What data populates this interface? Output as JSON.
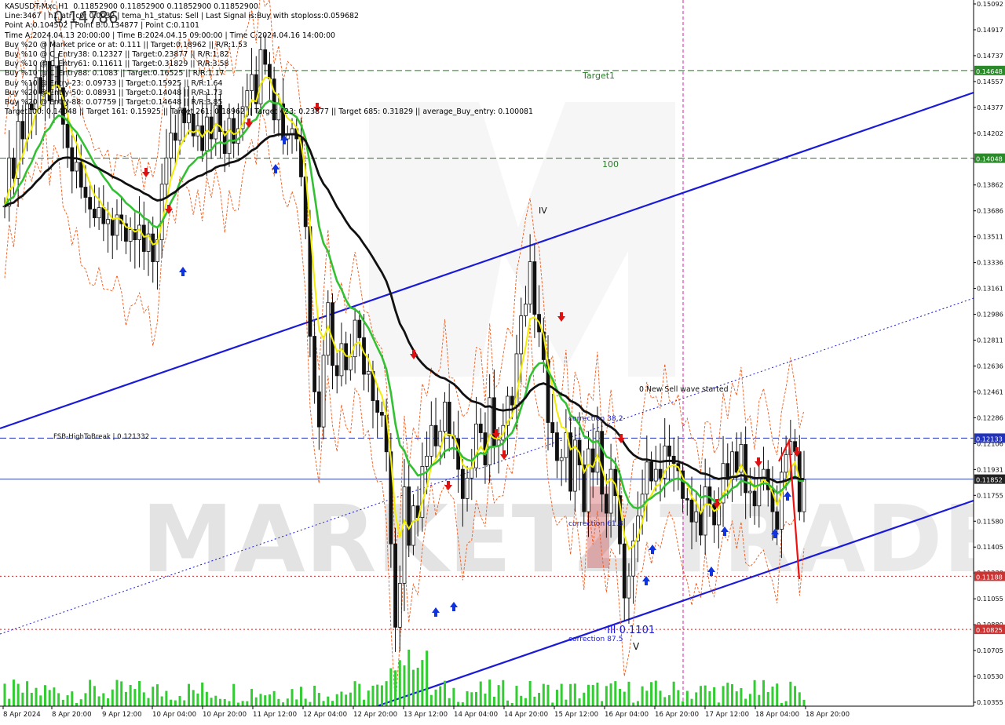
{
  "chart_data": {
    "type": "candlestick",
    "symbol": "KASUSDT-Mxc,H1",
    "ohlc_header": "0.11852900 0.11852900 0.11852900 0.11852900",
    "info_lines": [
      "KASUSDT-Mxc,H1  0.11852900 0.11852900 0.11852900 0.11852900",
      "Line:3467 | h1_atr_c0: 0.0032 | tema_h1_status: Sell | Last Signal is:Buy with stoploss:0.059682",
      "Point A:0.104502 | Point B:0.134877 | Point C:0.1101",
      "Time A:2024.04.13 20:00:00 | Time B:2024.04.15 09:00:00 | Time C:2024.04.16 14:00:00",
      "Buy %20 @ Market price or at: 0.111 || Target:0.18962 || R/R:1.53",
      "Buy %10 @ C_Entry38: 0.12327 || Target:0.23877 || R/R:1.82",
      "Buy %10 @ C_Entry61: 0.11611 || Target:0.31829 || R/R:3.58",
      "Buy %10 @ C_Entry88: 0.1083 || Target:0.16525 || R/R:1.17",
      "Buy %10 @ Entry-23: 0.09733 || Target:0.15925 || R/R:1.64",
      "Buy %20 @ Entry-50: 0.08931 || Target:0.14048 || R/R:1.73",
      "Buy %20 @ Entry-88: 0.07759 || Target:0.14648 || R/R:3.85",
      "Target100: 0.14048 || Target 161: 0.15925 || Target 261: 0.18962 || Target 423: 0.23877 || Target 685: 0.31829 || average_Buy_entry: 0.100081"
    ],
    "overlay_big_label": "0.14786",
    "y_ticks": [
      "0.15092",
      "0.14917",
      "0.14737",
      "0.14557",
      "0.14377",
      "0.14202",
      "0.14022",
      "0.13862",
      "0.13686",
      "0.13511",
      "0.13336",
      "0.13161",
      "0.12986",
      "0.12811",
      "0.12636",
      "0.12461",
      "0.12286",
      "0.12106",
      "0.11931",
      "0.11755",
      "0.11580",
      "0.11405",
      "0.11230",
      "0.11055",
      "0.10880",
      "0.10705",
      "0.10530",
      "0.10355"
    ],
    "x_ticks": [
      "8 Apr 2024",
      "8 Apr 20:00",
      "9 Apr 12:00",
      "10 Apr 04:00",
      "10 Apr 20:00",
      "11 Apr 12:00",
      "12 Apr 04:00",
      "12 Apr 20:00",
      "13 Apr 12:00",
      "14 Apr 04:00",
      "14 Apr 20:00",
      "15 Apr 12:00",
      "16 Apr 04:00",
      "16 Apr 20:00",
      "17 Apr 12:00",
      "18 Apr 04:00",
      "18 Apr 20:00"
    ],
    "levels": [
      {
        "label": "Target1",
        "price": 0.14648,
        "tag": "0.14648",
        "color": "#1e7b1e",
        "style": "dashed"
      },
      {
        "label": "100",
        "price": 0.14048,
        "tag": "0.14048",
        "color": "#1e7b1e",
        "style": "dashed"
      },
      {
        "label": "FSB-HighToBreak | 0.121332",
        "price": 0.121332,
        "tag": "0.12133",
        "color": "#2233bb",
        "style": "dashed"
      },
      {
        "label": "",
        "price": 0.118529,
        "tag": "0.11852",
        "color": "#3344aa",
        "style": "solid"
      },
      {
        "label": "",
        "price": 0.111886,
        "tag": "0.11188",
        "color": "#cc2222",
        "style": "dotted"
      },
      {
        "label": "",
        "price": 0.108253,
        "tag": "0.10825",
        "color": "#cc2222",
        "style": "dotted"
      }
    ],
    "annotations": [
      "IV",
      "0 New Sell wave started",
      "correction 38.2",
      "correction 61.8",
      "correction 87.5",
      "III 0.1101",
      "V"
    ],
    "close": [
      0.1372,
      0.1405,
      0.1391,
      0.143,
      0.1418,
      0.1442,
      0.1438,
      0.146,
      0.1449,
      0.1471,
      0.1444,
      0.1468,
      0.1453,
      0.1428,
      0.1412,
      0.1396,
      0.1402,
      0.1385,
      0.1378,
      0.137,
      0.1364,
      0.1371,
      0.136,
      0.1363,
      0.1352,
      0.1366,
      0.136,
      0.1348,
      0.1356,
      0.1349,
      0.1359,
      0.1341,
      0.1353,
      0.1334,
      0.1349,
      0.1387,
      0.1405,
      0.1422,
      0.1417,
      0.1439,
      0.1429,
      0.1435,
      0.142,
      0.1427,
      0.141,
      0.1433,
      0.1418,
      0.1441,
      0.1423,
      0.1408,
      0.1432,
      0.1415,
      0.1425,
      0.144,
      0.1451,
      0.1462,
      0.1442,
      0.1479,
      0.1469,
      0.1459,
      0.1431,
      0.1442,
      0.1418,
      0.1421,
      0.1425,
      0.1418,
      0.1392,
      0.1358,
      0.1283,
      0.1245,
      0.1221,
      0.127,
      0.1306,
      0.1263,
      0.1256,
      0.1278,
      0.126,
      0.1269,
      0.1294,
      0.1282,
      0.1257,
      0.1259,
      0.1239,
      0.1231,
      0.1229,
      0.1204,
      0.1141,
      0.1084,
      0.1114,
      0.118,
      0.114,
      0.1167,
      0.1159,
      0.1194,
      0.1201,
      0.1222,
      0.1208,
      0.1218,
      0.1238,
      0.1215,
      0.1213,
      0.1192,
      0.1172,
      0.1186,
      0.1193,
      0.1223,
      0.1217,
      0.1195,
      0.1241,
      0.1208,
      0.1212,
      0.1222,
      0.1242,
      0.1236,
      0.1271,
      0.1297,
      0.1305,
      0.1334,
      0.1298,
      0.1286,
      0.1267,
      0.1224,
      0.1217,
      0.1198,
      0.12,
      0.1217,
      0.1177,
      0.1212,
      0.1195,
      0.1163,
      0.1206,
      0.119,
      0.1218,
      0.1175,
      0.1162,
      0.1192,
      0.1174,
      0.1141,
      0.1104,
      0.1119,
      0.1143,
      0.116,
      0.1175,
      0.1197,
      0.1184,
      0.1192,
      0.1186,
      0.1208,
      0.1201,
      0.1196,
      0.1191,
      0.1172,
      0.1171,
      0.1156,
      0.1163,
      0.1147,
      0.118,
      0.1168,
      0.1154,
      0.1169,
      0.1196,
      0.1185,
      0.1204,
      0.119,
      0.1209,
      0.1176,
      0.1177,
      0.1167,
      0.1186,
      0.1192,
      0.1178,
      0.1163,
      0.1151,
      0.119,
      0.1202,
      0.1211,
      0.1204,
      0.1163,
      0.1185
    ],
    "ma_labels": [
      "EMA fast (yellow)",
      "EMA mid (green)",
      "EMA slow (black)"
    ]
  }
}
